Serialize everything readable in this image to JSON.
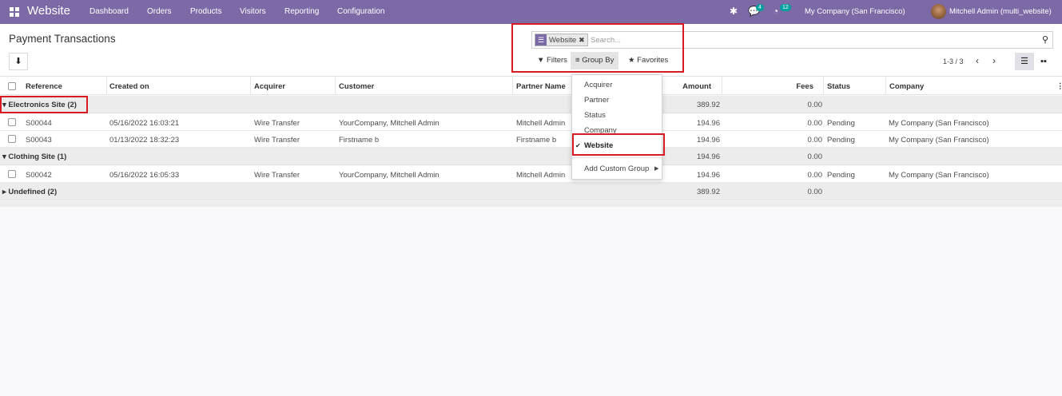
{
  "topbar": {
    "app_name": "Website",
    "menu": [
      "Dashboard",
      "Orders",
      "Products",
      "Visitors",
      "Reporting",
      "Configuration"
    ],
    "messages_count": "4",
    "activities_count": "12",
    "company": "My Company (San Francisco)",
    "user": "Mitchell Admin (multi_website)",
    "icons": [
      "apps-icon",
      "bug-icon",
      "chat-icon",
      "clock-icon",
      "avatar"
    ]
  },
  "control_panel": {
    "title": "Payment Transactions",
    "facet_label": "Website",
    "facet_remove": "✖",
    "search_placeholder": "Search...",
    "filters_label": "Filters",
    "group_by_label": "Group By",
    "favorites_label": "Favorites",
    "pager": "1-3 / 3"
  },
  "columns": [
    "Reference",
    "Created on",
    "Acquirer",
    "Customer",
    "Partner Name",
    "Amount",
    "Fees",
    "Status",
    "Company"
  ],
  "groups": [
    {
      "label": "Electronics Site (2)",
      "amount": "389.92",
      "fees": "0.00",
      "expanded": true,
      "rows": [
        {
          "reference": "S00044",
          "created_on": "05/16/2022 16:03:21",
          "acquirer": "Wire Transfer",
          "customer": "YourCompany, Mitchell Admin",
          "partner": "Mitchell Admin",
          "amount": "194.96",
          "fees": "0.00",
          "status": "Pending",
          "company": "My Company (San Francisco)"
        },
        {
          "reference": "S00043",
          "created_on": "01/13/2022 18:32:23",
          "acquirer": "Wire Transfer",
          "customer": "Firstname b",
          "partner": "Firstname b",
          "amount": "194.96",
          "fees": "0.00",
          "status": "Pending",
          "company": "My Company (San Francisco)"
        }
      ]
    },
    {
      "label": "Clothing Site (1)",
      "amount": "194.96",
      "fees": "0.00",
      "expanded": true,
      "rows": [
        {
          "reference": "S00042",
          "created_on": "05/16/2022 16:05:33",
          "acquirer": "Wire Transfer",
          "customer": "YourCompany, Mitchell Admin",
          "partner": "Mitchell Admin",
          "amount": "194.96",
          "fees": "0.00",
          "status": "Pending",
          "company": "My Company (San Francisco)"
        }
      ]
    },
    {
      "label": "Undefined (2)",
      "amount": "389.92",
      "fees": "0.00",
      "expanded": false,
      "rows": []
    }
  ],
  "group_by_menu": {
    "items": [
      "Acquirer",
      "Partner",
      "Status",
      "Company",
      "Website"
    ],
    "selected": "Website",
    "custom": "Add Custom Group"
  },
  "colors": {
    "topbar": "#7c6aa6",
    "highlight": "#d81b22",
    "group_row": "#ececec"
  }
}
